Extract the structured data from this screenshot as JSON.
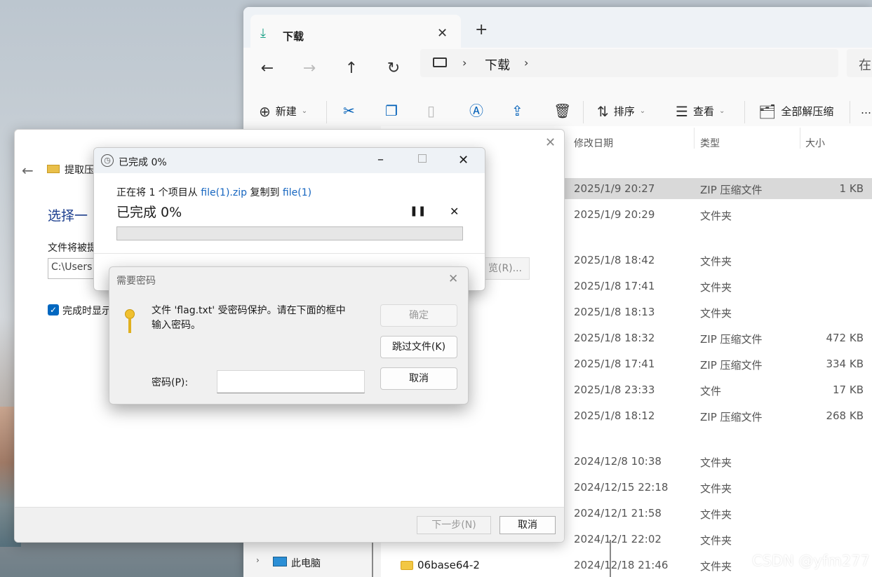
{
  "explorer": {
    "tab_title": "下载",
    "address_label": "下载",
    "search_placeholder": "在",
    "toolbar": {
      "new_label": "新建",
      "sort_label": "排序",
      "view_label": "查看",
      "extract_all_label": "全部解压缩",
      "more_label": "…"
    },
    "columns": {
      "date": "修改日期",
      "type": "类型",
      "size": "大小"
    },
    "rows": [
      {
        "date": "2025/1/9 20:27",
        "type": "ZIP 压缩文件",
        "size": "1 KB",
        "selected": true
      },
      {
        "date": "2025/1/9 20:29",
        "type": "文件夹",
        "size": ""
      },
      {
        "date": "2025/1/8 18:42",
        "type": "文件夹",
        "size": ""
      },
      {
        "date": "2025/1/8 17:41",
        "type": "文件夹",
        "size": ""
      },
      {
        "date": "2025/1/8 18:13",
        "type": "文件夹",
        "size": ""
      },
      {
        "date": "2025/1/8 18:32",
        "type": "ZIP 压缩文件",
        "size": "472 KB"
      },
      {
        "date": "2025/1/8 17:41",
        "type": "ZIP 压缩文件",
        "size": "334 KB"
      },
      {
        "date": "2025/1/8 23:33",
        "type": "文件",
        "size": "17 KB"
      },
      {
        "date": "2025/1/8 18:12",
        "type": "ZIP 压缩文件",
        "size": "268 KB"
      },
      {
        "date": "2024/12/8 10:38",
        "type": "文件夹",
        "size": ""
      },
      {
        "date": "2024/12/15 22:18",
        "type": "文件夹",
        "size": ""
      },
      {
        "date": "2024/12/1 21:58",
        "type": "文件夹",
        "size": ""
      },
      {
        "date": "2024/12/1 22:02",
        "type": "文件夹",
        "size": ""
      },
      {
        "name": "06base64-2",
        "date": "2024/12/18 21:46",
        "type": "文件夹",
        "size": ""
      }
    ],
    "sidebar_pc_label": "此电脑"
  },
  "wizard": {
    "title": "提取压",
    "heading": "选择一",
    "dest_label": "文件将被提",
    "dest_value": "C:\\Users",
    "browse_label": "览(R)...",
    "show_files_label": "完成时显示",
    "next_label": "下一步(N)",
    "cancel_label": "取消"
  },
  "progress": {
    "title": "已完成 0%",
    "line_prefix": "正在将 1 个项目从 ",
    "source": "file(1).zip",
    "line_middle": " 复制到 ",
    "dest": "file(1)",
    "status": "已完成 0%",
    "percent": 0
  },
  "password": {
    "title": "需要密码",
    "message_line1": "文件 'flag.txt' 受密码保护。请在下面的框中",
    "message_line2": "输入密码。",
    "ok_label": "确定",
    "skip_label": "跳过文件(K)",
    "cancel_label": "取消",
    "field_label": "密码(P):",
    "field_value": ""
  },
  "watermark": "CSDN @yfm277"
}
